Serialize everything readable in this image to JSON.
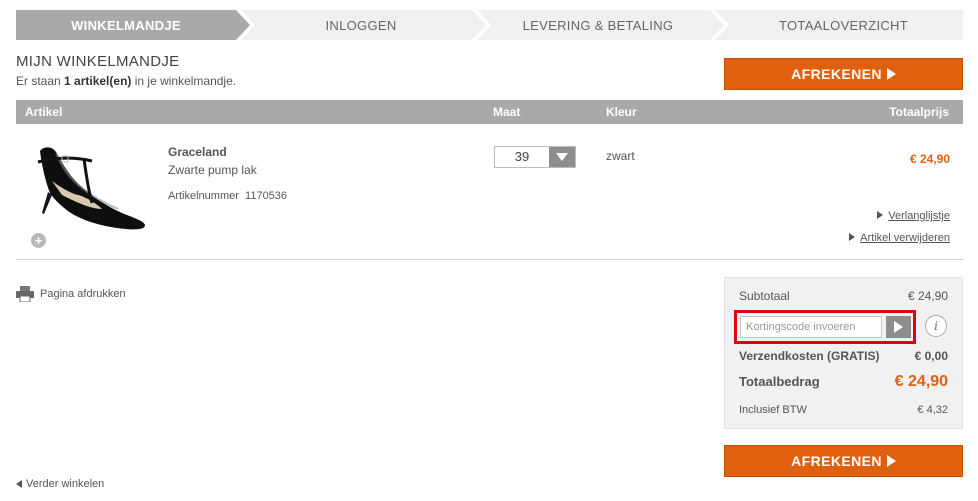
{
  "steps": [
    {
      "label": "WINKELMANDJE",
      "active": true
    },
    {
      "label": "INLOGGEN",
      "active": false
    },
    {
      "label": "LEVERING & BETALING",
      "active": false
    },
    {
      "label": "TOTAALOVERZICHT",
      "active": false
    }
  ],
  "header": {
    "title": "MIJN WINKELMANDJE",
    "count_prefix": "Er staan ",
    "count_bold": "1 artikel(en)",
    "count_suffix": " in je winkelmandje."
  },
  "checkout_label": "AFREKENEN",
  "table": {
    "columns": [
      "Artikel",
      "Maat",
      "Kleur",
      "Totaalprijs"
    ]
  },
  "item": {
    "brand": "Graceland",
    "description": "Zwarte pump lak",
    "sku_label": "Artikelnummer",
    "sku": "1170536",
    "size": "39",
    "color": "zwart",
    "price": "€ 24,90",
    "wishlist_link": "Verlanglijstje",
    "remove_link": "Artikel verwijderen"
  },
  "print_label": "Pagina afdrukken",
  "summary": {
    "subtotal_label": "Subtotaal",
    "subtotal": "€ 24,90",
    "promo_placeholder": "Kortingscode invoeren",
    "shipping_label": "Verzendkosten (GRATIS)",
    "shipping": "€ 0,00",
    "total_label": "Totaalbedrag",
    "total": "€ 24,90",
    "vat_label": "Inclusief BTW",
    "vat": "€ 4,32"
  },
  "continue_label": "Verder winkelen",
  "colors": {
    "accent": "#e0600f",
    "step_active": "#a9a9a9",
    "step_inactive": "#f0f0f0",
    "highlight": "#e0000f"
  }
}
